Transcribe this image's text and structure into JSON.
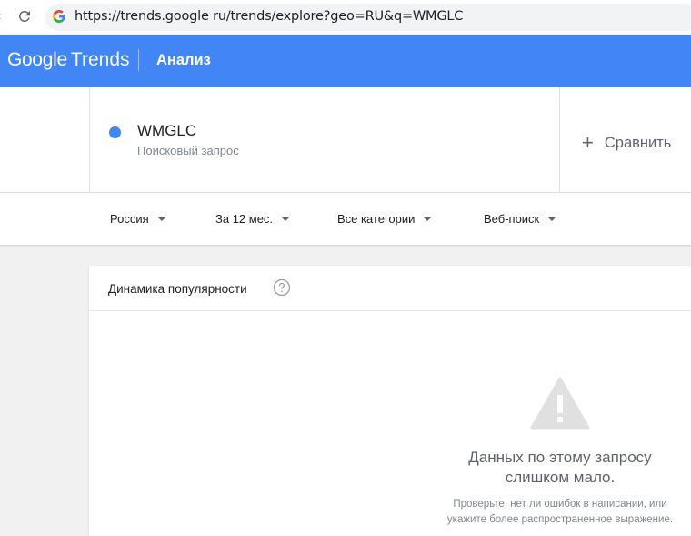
{
  "browser": {
    "url": "https://trends.google ru/trends/explore?geo=RU&q=WMGLC"
  },
  "header": {
    "logo_google": "Google",
    "logo_trends": "Trends",
    "title": "Анализ",
    "color": "#4285f4"
  },
  "terms": {
    "term": "WMGLC",
    "term_type": "Поисковый запрос",
    "term_color": "#4285f4",
    "compare_label": "Сравнить"
  },
  "filters": {
    "region": "Россия",
    "period": "За 12 мес.",
    "category": "Все категории",
    "search_type": "Веб-поиск"
  },
  "interest_card": {
    "title": "Динамика популярности",
    "empty_line1": "Данных по этому запросу",
    "empty_line2": "слишком мало.",
    "hint_line1": "Проверьте, нет ли ошибок в написании, или",
    "hint_line2": "укажите более распространенное выражение."
  }
}
